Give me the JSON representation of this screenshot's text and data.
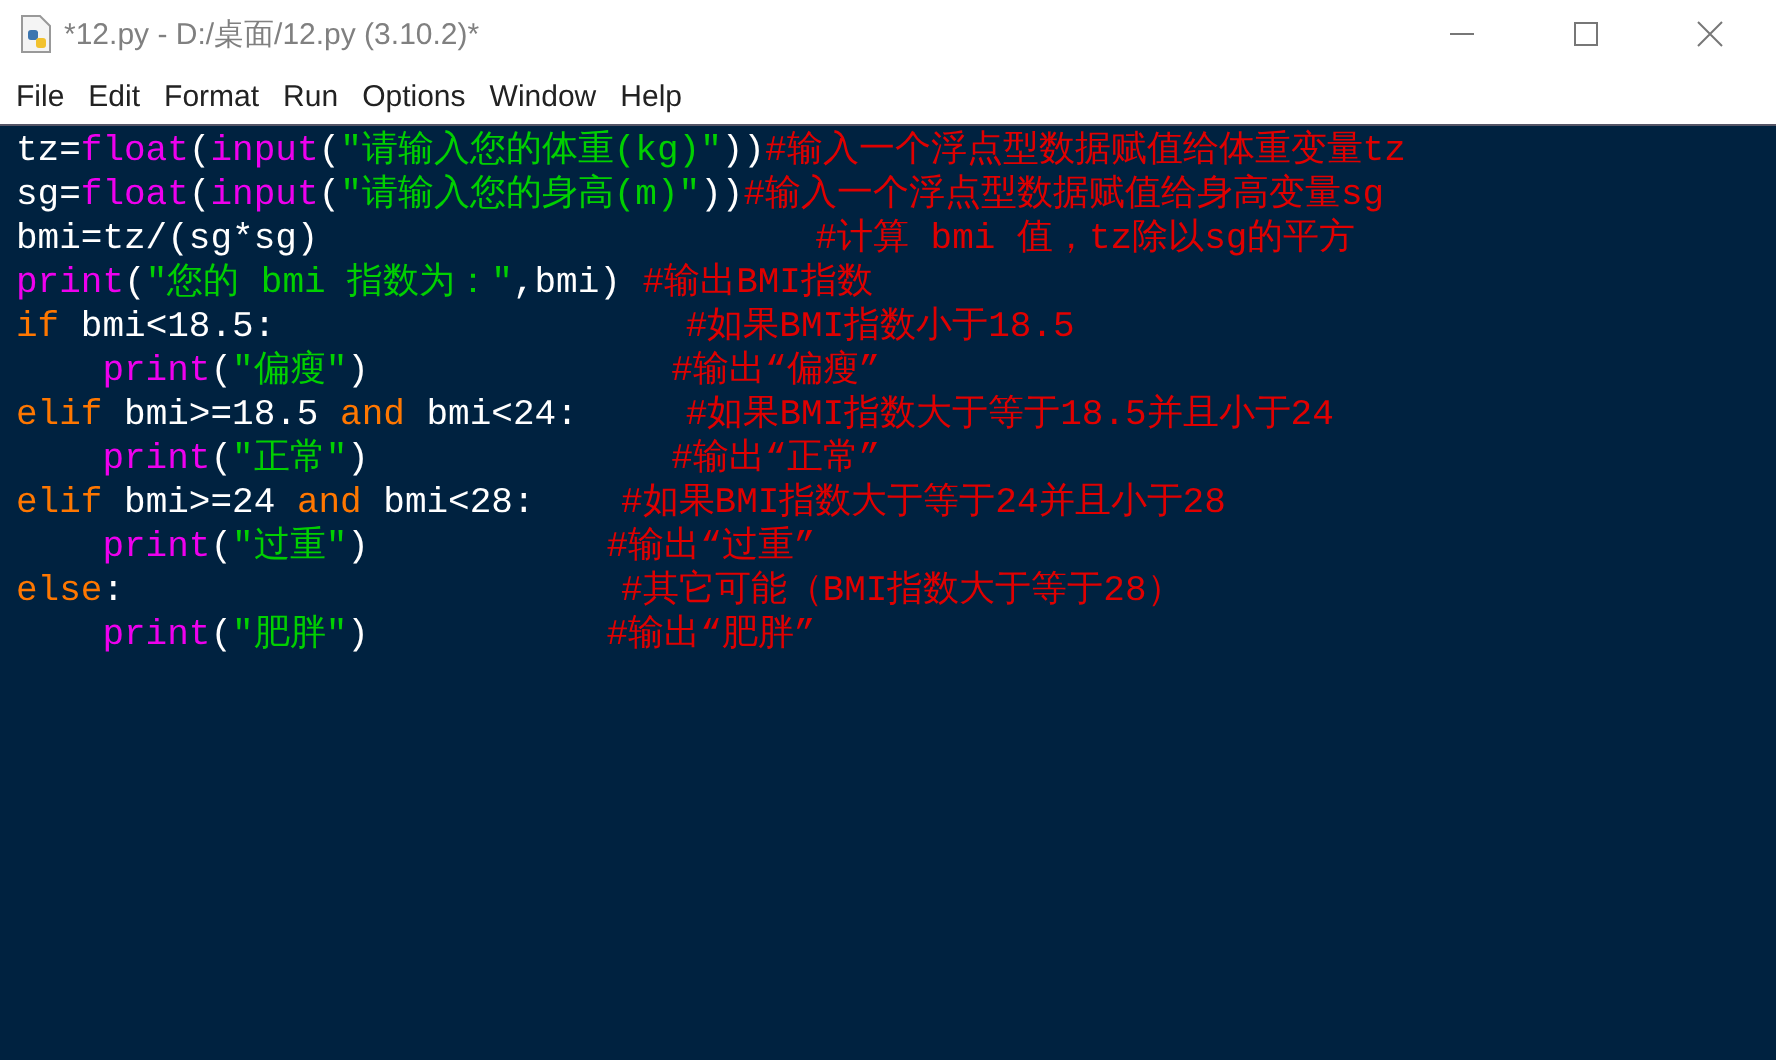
{
  "window": {
    "title": "*12.py - D:/桌面/12.py (3.10.2)*"
  },
  "menu": [
    "File",
    "Edit",
    "Format",
    "Run",
    "Options",
    "Window",
    "Help"
  ],
  "code_lines": [
    {
      "tokens": [
        {
          "kind": "plain",
          "text": "tz="
        },
        {
          "kind": "builtin",
          "text": "float"
        },
        {
          "kind": "plain",
          "text": "("
        },
        {
          "kind": "builtin",
          "text": "input"
        },
        {
          "kind": "plain",
          "text": "("
        },
        {
          "kind": "string",
          "text": "\"请输入您的体重(kg)\""
        },
        {
          "kind": "plain",
          "text": "))"
        },
        {
          "kind": "comment",
          "text": "#输入一个浮点型数据赋值给体重变量tz"
        }
      ]
    },
    {
      "tokens": [
        {
          "kind": "plain",
          "text": "sg="
        },
        {
          "kind": "builtin",
          "text": "float"
        },
        {
          "kind": "plain",
          "text": "("
        },
        {
          "kind": "builtin",
          "text": "input"
        },
        {
          "kind": "plain",
          "text": "("
        },
        {
          "kind": "string",
          "text": "\"请输入您的身高(m)\""
        },
        {
          "kind": "plain",
          "text": "))"
        },
        {
          "kind": "comment",
          "text": "#输入一个浮点型数据赋值给身高变量sg"
        }
      ]
    },
    {
      "tokens": [
        {
          "kind": "plain",
          "text": "bmi=tz/(sg*sg)                       "
        },
        {
          "kind": "comment",
          "text": "#计算 bmi 值，tz除以sg的平方"
        }
      ]
    },
    {
      "tokens": [
        {
          "kind": "builtin",
          "text": "print"
        },
        {
          "kind": "plain",
          "text": "("
        },
        {
          "kind": "string",
          "text": "\"您的 bmi 指数为：\""
        },
        {
          "kind": "plain",
          "text": ",bmi) "
        },
        {
          "kind": "comment",
          "text": "#输出BMI指数"
        }
      ]
    },
    {
      "tokens": [
        {
          "kind": "keyword",
          "text": "if"
        },
        {
          "kind": "plain",
          "text": " bmi<18.5:                   "
        },
        {
          "kind": "comment",
          "text": "#如果BMI指数小于18.5"
        }
      ]
    },
    {
      "indented": true,
      "tokens": [
        {
          "kind": "builtin",
          "text": "print"
        },
        {
          "kind": "plain",
          "text": "("
        },
        {
          "kind": "string",
          "text": "\"偏瘦\""
        },
        {
          "kind": "plain",
          "text": ")              "
        },
        {
          "kind": "comment",
          "text": "#输出“偏瘦”"
        }
      ]
    },
    {
      "tokens": [
        {
          "kind": "keyword",
          "text": "elif"
        },
        {
          "kind": "plain",
          "text": " bmi>=18.5 "
        },
        {
          "kind": "keyword",
          "text": "and"
        },
        {
          "kind": "plain",
          "text": " bmi<24:     "
        },
        {
          "kind": "comment",
          "text": "#如果BMI指数大于等于18.5并且小于24"
        }
      ]
    },
    {
      "indented": true,
      "tokens": [
        {
          "kind": "builtin",
          "text": "print"
        },
        {
          "kind": "plain",
          "text": "("
        },
        {
          "kind": "string",
          "text": "\"正常\""
        },
        {
          "kind": "plain",
          "text": ")              "
        },
        {
          "kind": "comment",
          "text": "#输出“正常”"
        }
      ]
    },
    {
      "tokens": [
        {
          "kind": "keyword",
          "text": "elif"
        },
        {
          "kind": "plain",
          "text": " bmi>=24 "
        },
        {
          "kind": "keyword",
          "text": "and"
        },
        {
          "kind": "plain",
          "text": " bmi<28:    "
        },
        {
          "kind": "comment",
          "text": "#如果BMI指数大于等于24并且小于28"
        }
      ]
    },
    {
      "indented": true,
      "tokens": [
        {
          "kind": "builtin",
          "text": "print"
        },
        {
          "kind": "plain",
          "text": "("
        },
        {
          "kind": "string",
          "text": "\"过重\""
        },
        {
          "kind": "plain",
          "text": ")           "
        },
        {
          "kind": "comment",
          "text": "#输出“过重”"
        }
      ]
    },
    {
      "tokens": [
        {
          "kind": "keyword",
          "text": "else"
        },
        {
          "kind": "plain",
          "text": ":                       "
        },
        {
          "kind": "comment",
          "text": "#其它可能（BMI指数大于等于28）"
        }
      ]
    },
    {
      "indented": true,
      "tokens": [
        {
          "kind": "builtin",
          "text": "print"
        },
        {
          "kind": "plain",
          "text": "("
        },
        {
          "kind": "string",
          "text": "\"肥胖\""
        },
        {
          "kind": "plain",
          "text": ")           "
        },
        {
          "kind": "comment",
          "text": "#输出“肥胖”"
        }
      ]
    }
  ]
}
